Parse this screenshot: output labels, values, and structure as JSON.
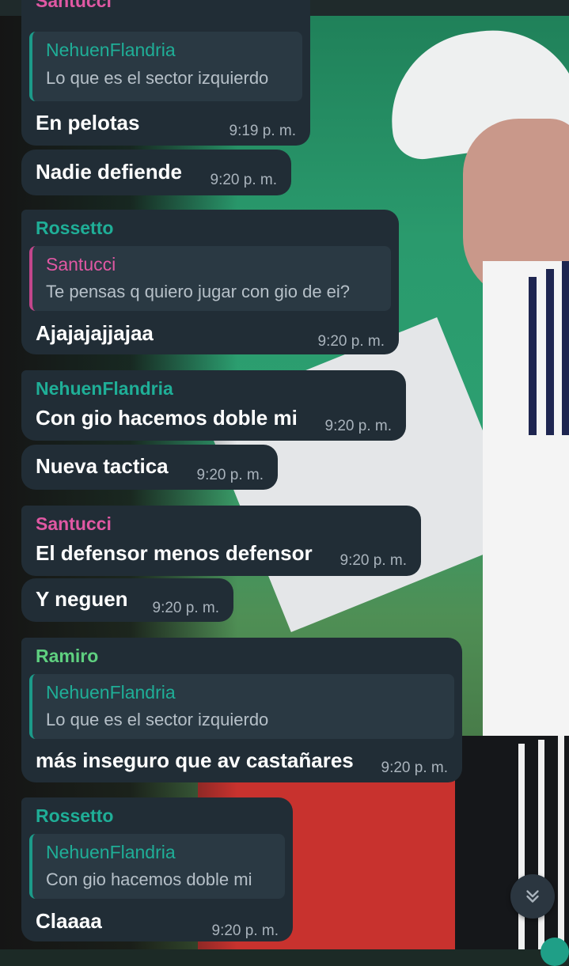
{
  "colors": {
    "bubble": "#212d36",
    "quote_bg": "#2a3943",
    "time": "#a9b3bc",
    "teal_name": "#1fae97",
    "pink_name": "#e058a3",
    "green_name": "#5fd080"
  },
  "messages": [
    {
      "sender": "Santucci",
      "quote_name": "NehuenFlandria",
      "quote_text": "Lo que es el sector izquierdo",
      "text": "En pelotas",
      "time": "9:19 p. m."
    },
    {
      "text": "Nadie defiende",
      "time": "9:20 p. m."
    },
    {
      "sender": "Rossetto",
      "quote_name": "Santucci",
      "quote_text": "Te pensas q quiero jugar con gio de ei?",
      "text": "Ajajajajjajaa",
      "time": "9:20 p. m."
    },
    {
      "sender": "NehuenFlandria",
      "text": "Con gio hacemos doble mi",
      "time": "9:20 p. m."
    },
    {
      "text": "Nueva tactica",
      "time": "9:20 p. m."
    },
    {
      "sender": "Santucci",
      "text": "El defensor menos defensor",
      "time": "9:20 p. m."
    },
    {
      "text": "Y neguen",
      "time": "9:20 p. m."
    },
    {
      "sender": "Ramiro",
      "quote_name": "NehuenFlandria",
      "quote_text": "Lo que es el sector izquierdo",
      "text": "más inseguro que av castañares",
      "time": "9:20 p. m."
    },
    {
      "sender": "Rossetto",
      "quote_name": "NehuenFlandria",
      "quote_text": "Con gio hacemos doble mi",
      "text": "Claaaa",
      "time": "9:20 p. m."
    }
  ],
  "scroll_down": {
    "icon": "chevrons-down-icon"
  }
}
